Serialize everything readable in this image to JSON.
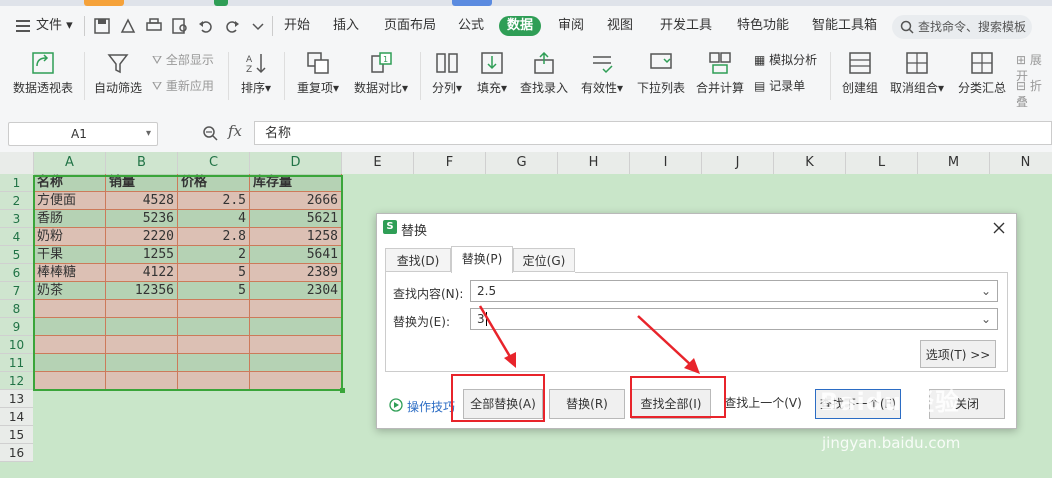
{
  "menubar": {
    "file_label": "文件",
    "tabs": [
      "开始",
      "插入",
      "页面布局",
      "公式",
      "数据",
      "审阅",
      "视图",
      "开发工具",
      "特色功能",
      "智能工具箱"
    ],
    "active_tab": "数据",
    "search_placeholder": "查找命令、搜索模板"
  },
  "ribbon": {
    "pivot": "数据透视表",
    "autofilter": "自动筛选",
    "show_all": "全部显示",
    "reapply": "重新应用",
    "sort": "排序",
    "duplicates": "重复项",
    "compare": "数据对比",
    "split": "分列",
    "fill": "填充",
    "lookup_entry": "查找录入",
    "validity": "有效性",
    "dropdown_list": "下拉列表",
    "consolidate": "合并计算",
    "simulate": "模拟分析",
    "record": "记录单",
    "group": "创建组",
    "ungroup": "取消组合",
    "subtotal": "分类汇总",
    "expand": "展开",
    "collapse": "折叠"
  },
  "formula_bar": {
    "cell_ref": "A1",
    "fx": "fx",
    "content": "名称"
  },
  "sheet": {
    "columns": [
      "A",
      "B",
      "C",
      "D",
      "E",
      "F",
      "G",
      "H",
      "I",
      "J",
      "K",
      "L",
      "M",
      "N"
    ],
    "rows": [
      "1",
      "2",
      "3",
      "4",
      "5",
      "6",
      "7",
      "8",
      "9",
      "10",
      "11",
      "12",
      "13",
      "14",
      "15",
      "16"
    ],
    "headers": [
      "名称",
      "销量",
      "价格",
      "库存量"
    ],
    "data": [
      [
        "方便面",
        "4528",
        "2.5",
        "2666"
      ],
      [
        "香肠",
        "5236",
        "4",
        "5621"
      ],
      [
        "奶粉",
        "2220",
        "2.8",
        "1258"
      ],
      [
        "干果",
        "1255",
        "2",
        "5641"
      ],
      [
        "棒棒糖",
        "4122",
        "5",
        "2389"
      ],
      [
        "奶茶",
        "12356",
        "5",
        "2304"
      ]
    ]
  },
  "dialog": {
    "title": "替换",
    "tabs": [
      "查找(D)",
      "替换(P)",
      "定位(G)"
    ],
    "find_label": "查找内容(N):",
    "find_value": "2.5",
    "replace_label": "替换为(E):",
    "replace_value": "3",
    "options_button": "选项(T) >>",
    "tips": "操作技巧",
    "replace_all": "全部替换(A)",
    "replace": "替换(R)",
    "find_all": "查找全部(I)",
    "find_prev": "查找上一个(V)",
    "find_next": "查找下一个(F)",
    "close": "关闭"
  },
  "watermark": {
    "brand": "Baidu",
    "brand_cn": "经验",
    "url": "jingyan.baidu.com"
  },
  "colors": {
    "accent_green": "#2f9e56",
    "sheet_bg": "#c9e6c9",
    "cell_fill": "#dcc0b4",
    "cell_border": "#cc7a5a",
    "selection_border": "#3aa53a",
    "highlight_red": "#e8242b"
  }
}
